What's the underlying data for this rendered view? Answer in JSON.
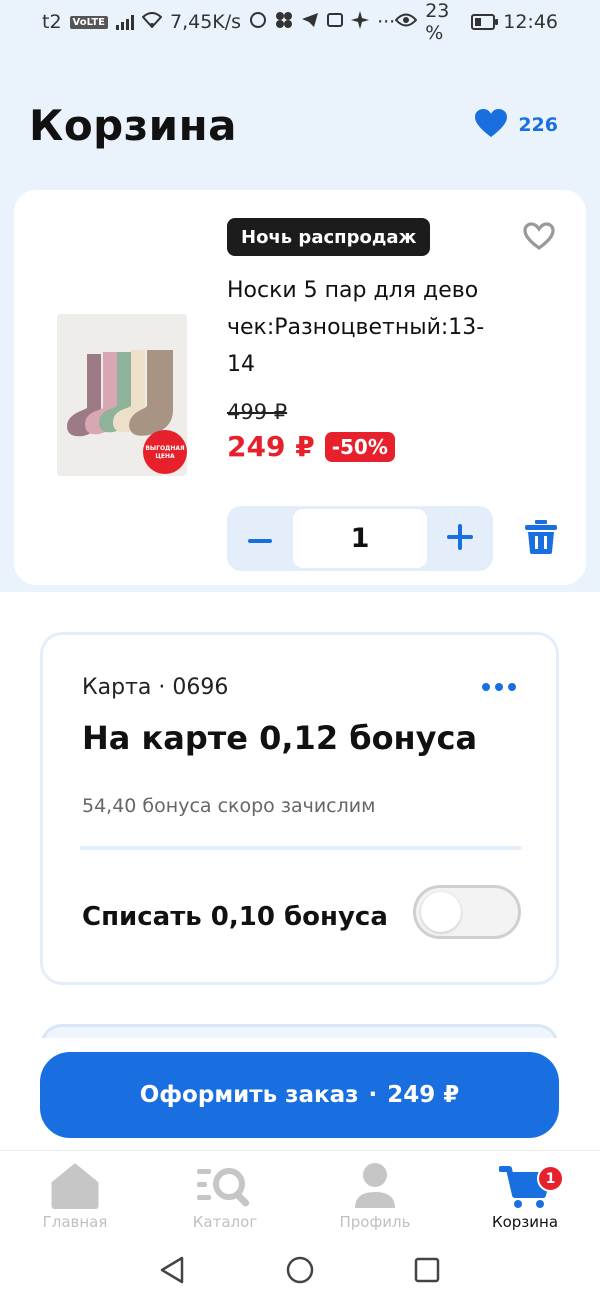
{
  "status_bar": {
    "carrier": "t2",
    "volte": "VoLTE",
    "net_speed": "7,45K/s",
    "battery": "23 %",
    "time": "12:46",
    "overflow": "···"
  },
  "header": {
    "title": "Корзина",
    "favorites_count": "226"
  },
  "product": {
    "badge": "Ночь распродаж",
    "name": "Носки 5 пар для девочек:Разноцветный:13-14",
    "old_price": "499 ₽",
    "new_price": "249 ₽",
    "discount": "-50%",
    "image_sticker": "ВЫГОДНАЯ ЦЕНА",
    "quantity": "1",
    "minus_symbol": "−",
    "plus_symbol": "+"
  },
  "bonus": {
    "card_label": "Карта · 0696",
    "balance": "На карте 0,12 бонуса",
    "pending": "54,40 бонуса скоро зачислим",
    "spend_label": "Списать 0,10 бонуса",
    "spend_enabled": false
  },
  "checkout": {
    "label": "Оформить заказ",
    "separator": "·",
    "total": "249 ₽"
  },
  "nav": {
    "items": [
      {
        "label": "Главная",
        "icon": "home-icon",
        "active": false
      },
      {
        "label": "Каталог",
        "icon": "catalog-search-icon",
        "active": false
      },
      {
        "label": "Профиль",
        "icon": "profile-icon",
        "active": false
      },
      {
        "label": "Корзина",
        "icon": "cart-icon",
        "active": true
      }
    ],
    "cart_badge": "1"
  },
  "colors": {
    "accent": "#1a6fe0",
    "sale_red": "#e6212b",
    "page_bg_top": "#eaf2fb",
    "stepper_bg": "#e4eefa"
  }
}
